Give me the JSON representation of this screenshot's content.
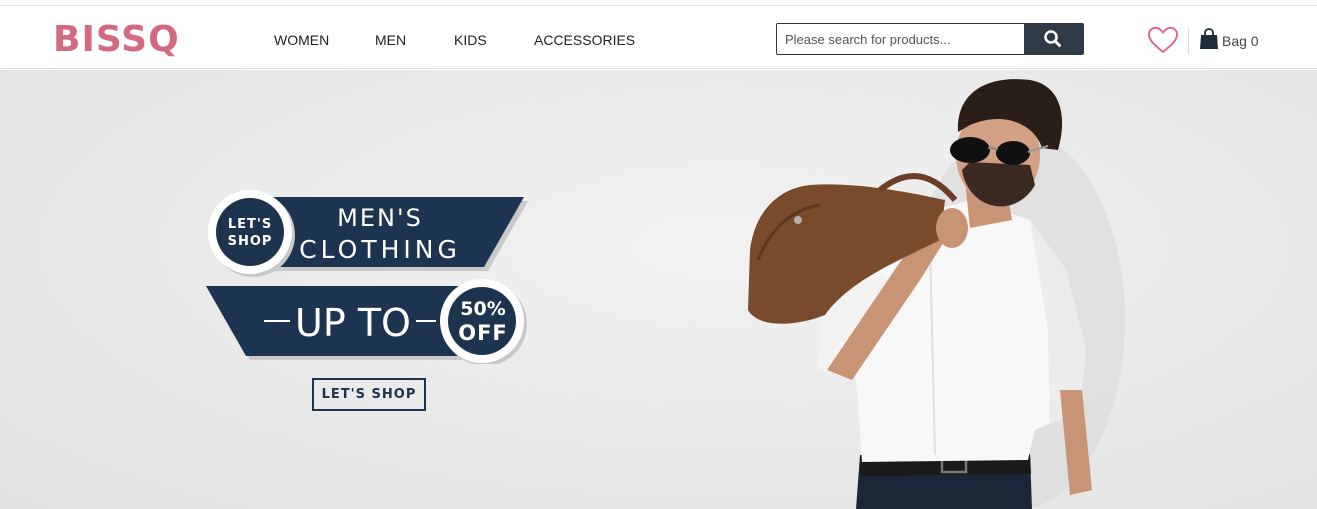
{
  "header": {
    "logo": "BISSQ",
    "nav": [
      {
        "label": "WOMEN"
      },
      {
        "label": "MEN"
      },
      {
        "label": "KIDS"
      },
      {
        "label": "ACCESSORIES"
      }
    ],
    "search": {
      "placeholder": "Please search for products...",
      "value": "",
      "button_icon": "search-icon"
    },
    "wishlist_icon": "heart-icon",
    "bag": {
      "icon": "shopping-bag-icon",
      "label": "Bag 0"
    }
  },
  "hero": {
    "badge_line1": "LET'S",
    "badge_line2": "SHOP",
    "title_line1": "MEN'S",
    "title_line2": "CLOTHING",
    "offer_text": "UP TO",
    "offer_badge_line1": "50%",
    "offer_badge_line2": "OFF",
    "cta_label": "LET'S SHOP"
  },
  "colors": {
    "brand": "#d46a82",
    "navy": "#1c344f",
    "search_button": "#2e3a46"
  }
}
